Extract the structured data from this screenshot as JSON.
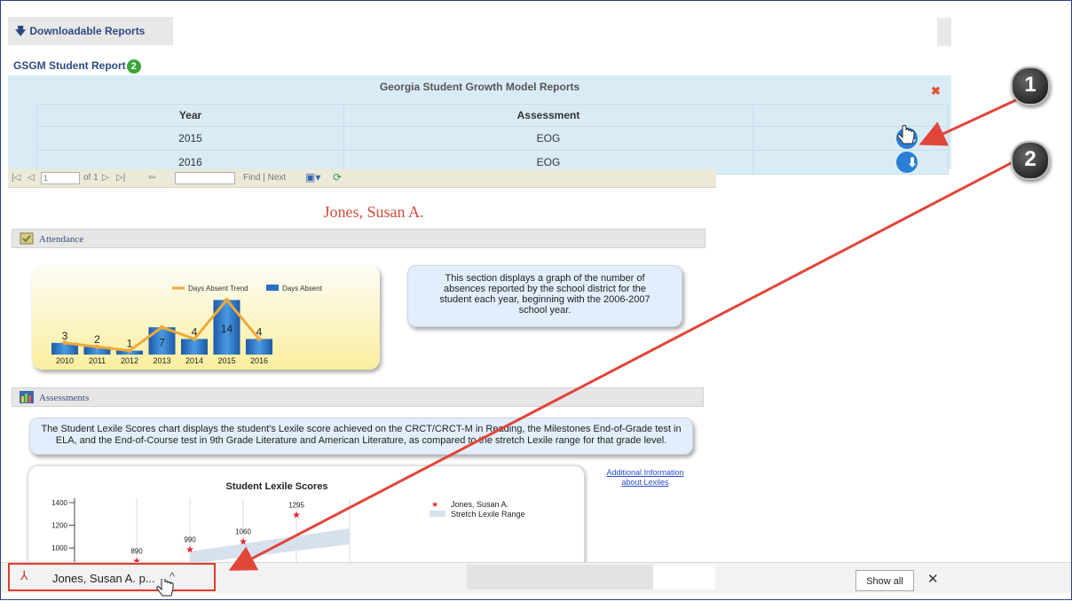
{
  "top": {
    "downloadable_reports": "Downloadable Reports",
    "arrow": "🡇"
  },
  "gsgm": {
    "label": "GSGM Student Report",
    "badge": "2"
  },
  "panel": {
    "title": "Georgia Student Growth Model Reports",
    "close": "✖",
    "headers": [
      "Year",
      "Assessment",
      ""
    ],
    "rows": [
      {
        "year": "2015",
        "assessment": "EOG"
      },
      {
        "year": "2016",
        "assessment": "EOG"
      }
    ]
  },
  "toolbar": {
    "page_value": "1",
    "of_pages": "of 1",
    "find_next": "Find | Next"
  },
  "student_name": "Jones, Susan A.",
  "sections": {
    "attendance": "Attendance",
    "assessments": "Assessments"
  },
  "attendance_info": "This section displays a graph of the number of absences reported by the school district for the student each year, beginning with the 2006-2007 school year.",
  "lexile_info": "The Student Lexile Scores chart displays the student's Lexile score achieved on the CRCT/CRCT-M in Reading, the Milestones End-of-Grade test in ELA, and the End-of-Course test in 9th Grade Literature and American Literature, as compared to the stretch Lexile range for that grade level.",
  "additional_info": "Additional Information about Lexiles",
  "download_bar": {
    "file_label": "Jones, Susan A. p...",
    "chevron": "^",
    "show_all": "Show all",
    "close": "✕"
  },
  "callouts": [
    "1",
    "2"
  ],
  "colors": {
    "accent": "#2e4a83",
    "panel_bg": "#d9ecf6",
    "highlight": "#e23b2c",
    "name_red": "#d04a3a"
  },
  "chart_data": [
    {
      "type": "bar",
      "title": "",
      "categories": [
        "2010",
        "2011",
        "2012",
        "2013",
        "2014",
        "2015",
        "2016"
      ],
      "series": [
        {
          "name": "Days Absent",
          "values": [
            3,
            2,
            1,
            7,
            4,
            14,
            4
          ]
        },
        {
          "name": "Days Absent Trend",
          "values": [
            3,
            2,
            1,
            7,
            4,
            14,
            4
          ]
        }
      ],
      "legend": "top-right"
    },
    {
      "type": "scatter",
      "title": "Student Lexile Scores",
      "y_ticks": [
        "1400",
        "1200",
        "1000"
      ],
      "series": [
        {
          "name": "Jones, Susan A.",
          "values": [
            890,
            990,
            1060,
            1295
          ]
        },
        {
          "name": "Stretch Lexile Range",
          "values": []
        }
      ],
      "legend": "right"
    }
  ]
}
